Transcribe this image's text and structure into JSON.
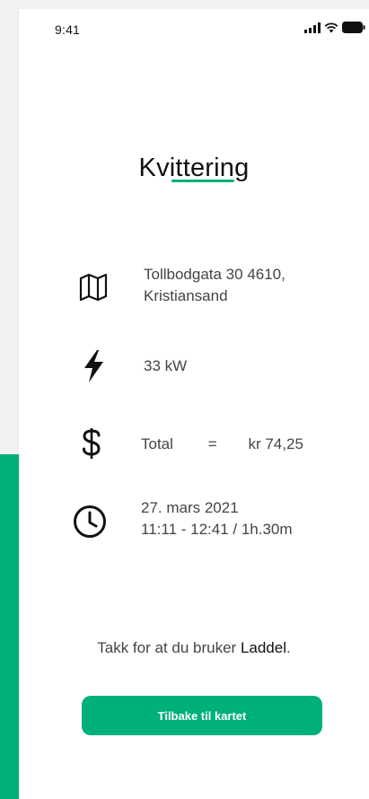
{
  "status_bar": {
    "time": "9:41"
  },
  "receipt": {
    "title": "Kvittering",
    "address_line1": "Tollbodgata 30 4610,",
    "address_line2": "Kristiansand",
    "power": "33 kW",
    "total_label": "Total",
    "total_equals": "=",
    "total_value": "kr 74,25",
    "date": "27. mars 2021",
    "time_range": "11:11 - 12:41 / 1h.30m"
  },
  "footer": {
    "thanks_text": "Takk for at du bruker ",
    "brand": "Laddel",
    "thanks_end": ".",
    "back_button_label": "Tilbake til kartet"
  },
  "icons": {
    "address": "map-icon",
    "power": "lightning-icon",
    "price": "dollar-icon",
    "time": "clock-icon"
  },
  "colors": {
    "accent": "#00b07a",
    "side_background": "#f2f2f2",
    "text_primary": "#111111",
    "text_secondary": "#444444"
  }
}
